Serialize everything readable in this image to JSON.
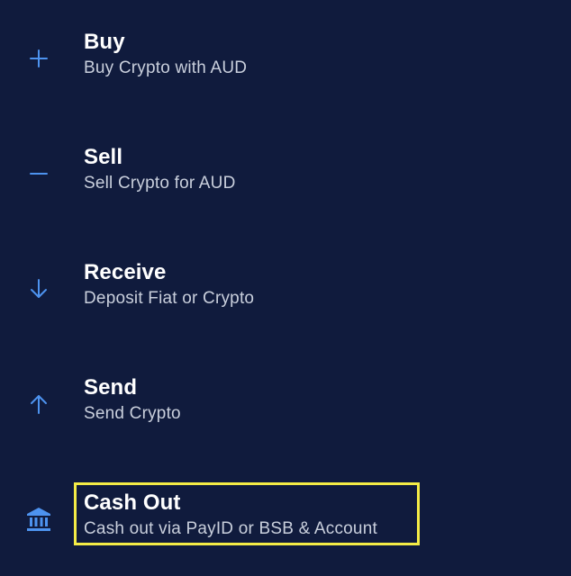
{
  "menu": {
    "items": [
      {
        "id": "buy",
        "icon": "plus-icon",
        "title": "Buy",
        "subtitle": "Buy Crypto with AUD"
      },
      {
        "id": "sell",
        "icon": "minus-icon",
        "title": "Sell",
        "subtitle": "Sell Crypto for AUD"
      },
      {
        "id": "receive",
        "icon": "arrow-down-icon",
        "title": "Receive",
        "subtitle": "Deposit Fiat or Crypto"
      },
      {
        "id": "send",
        "icon": "arrow-up-icon",
        "title": "Send",
        "subtitle": "Send Crypto"
      },
      {
        "id": "cashout",
        "icon": "bank-icon",
        "title": "Cash Out",
        "subtitle": "Cash out via PayID or BSB & Account",
        "highlighted": true
      }
    ]
  },
  "colors": {
    "background": "#101b3d",
    "icon": "#4d93ef",
    "title": "#ffffff",
    "subtitle": "#c9cfdc",
    "highlight": "#f4ec46"
  }
}
